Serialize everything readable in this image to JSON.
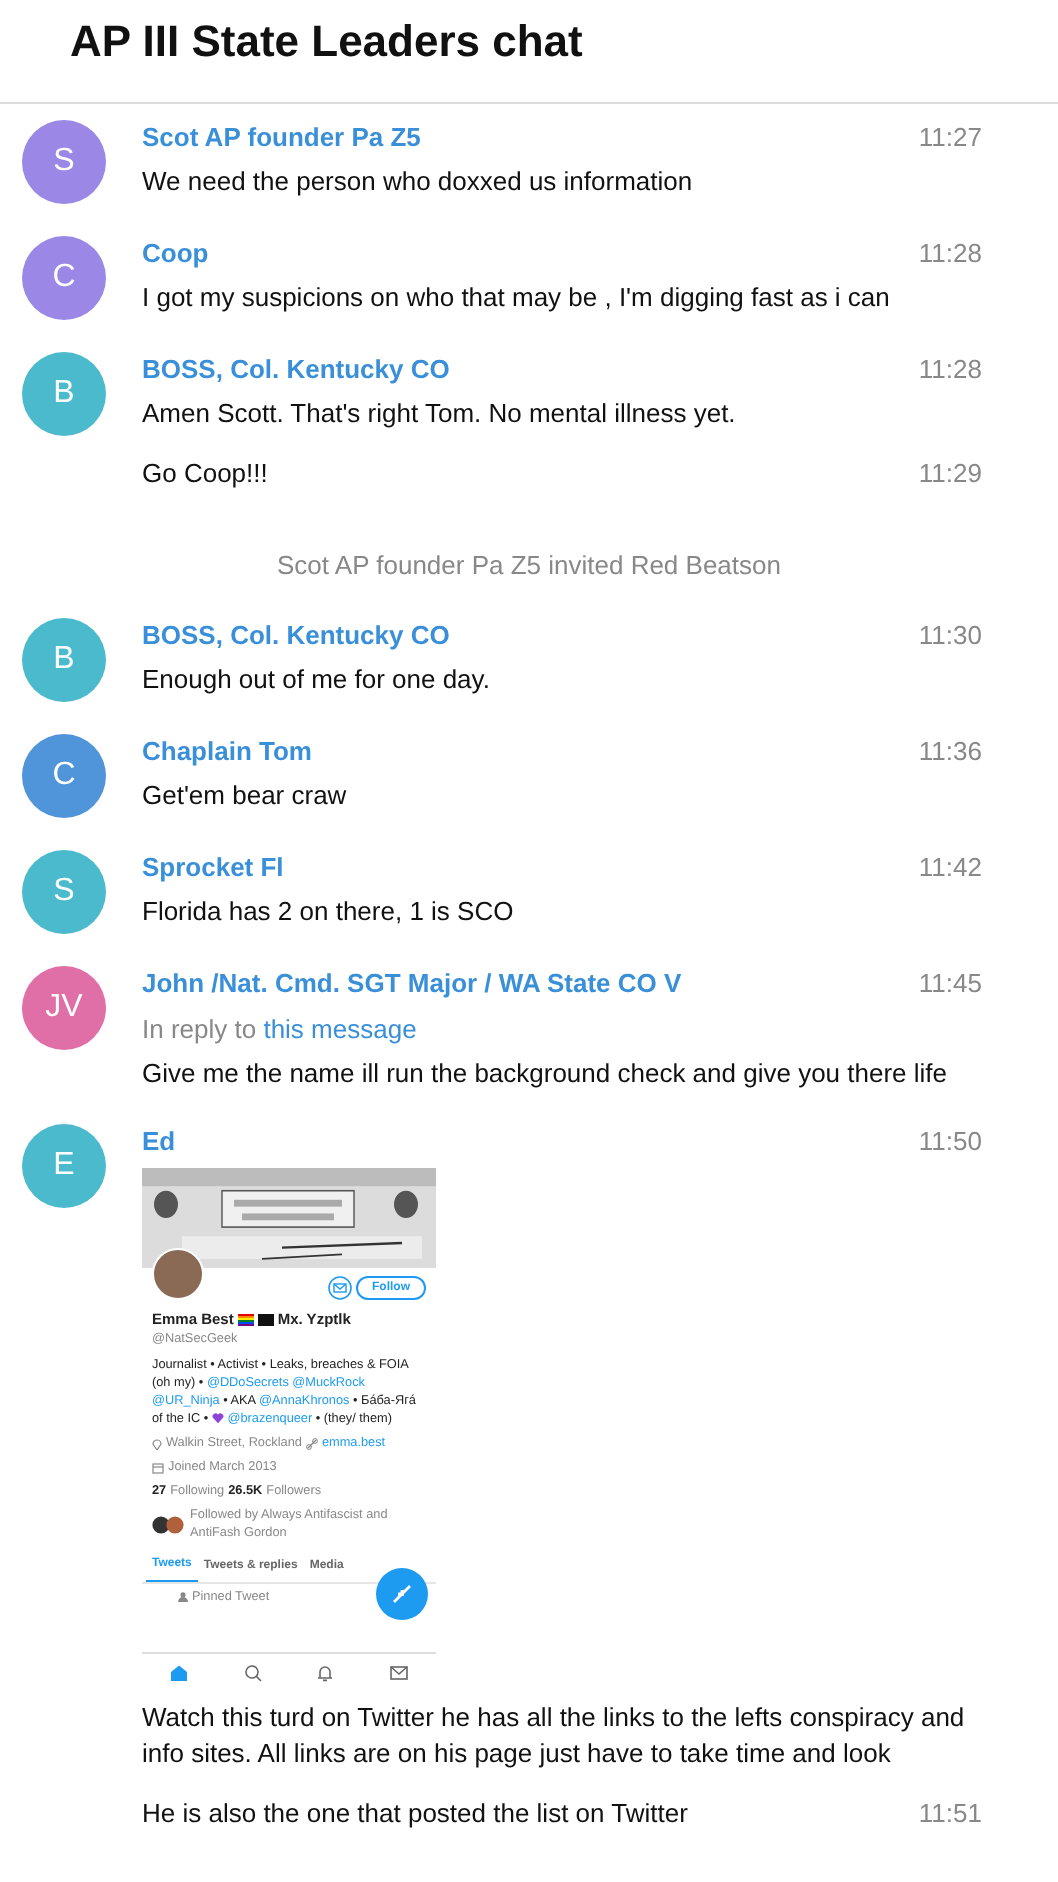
{
  "chat": {
    "title": "AP III State Leaders chat"
  },
  "items": [
    {
      "kind": "message",
      "initials": "S",
      "color": "#9b87e6",
      "author": "Scot AP founder Pa Z5",
      "time": "11:27",
      "text": "We need the person who doxxed us information"
    },
    {
      "kind": "message",
      "initials": "C",
      "color": "#9b87e6",
      "author": "Coop",
      "time": "11:28",
      "text": "I got my suspicions on who that may be , I'm digging fast as i can"
    },
    {
      "kind": "message",
      "initials": "B",
      "color": "#4bbacc",
      "author": "BOSS, Col. Kentucky CO",
      "time": "11:28",
      "text": "Amen Scott. That's right Tom. No mental illness yet.",
      "followups": [
        {
          "text": "Go Coop!!!",
          "time": "11:29"
        }
      ]
    },
    {
      "kind": "service",
      "text": "Scot AP founder Pa Z5 invited Red Beatson"
    },
    {
      "kind": "message",
      "initials": "B",
      "color": "#4bbacc",
      "author": "BOSS, Col. Kentucky CO",
      "time": "11:30",
      "text": "Enough out of me for one day."
    },
    {
      "kind": "message",
      "initials": "C",
      "color": "#5094d9",
      "author": "Chaplain Tom",
      "time": "11:36",
      "text": "Get'em bear craw"
    },
    {
      "kind": "message",
      "initials": "S",
      "color": "#4bbacc",
      "author": "Sprocket Fl",
      "time": "11:42",
      "text": "Florida has 2 on there, 1 is SCO"
    },
    {
      "kind": "message",
      "initials": "JV",
      "color": "#e06fa8",
      "author": "John /Nat. Cmd. SGT Major / WA State CO V",
      "time": "11:45",
      "reply": {
        "prefix": "In reply to",
        "link": "this message"
      },
      "text": "Give me the name ill run the background check and give you there life"
    },
    {
      "kind": "message",
      "initials": "E",
      "color": "#4bbacc",
      "author": "Ed",
      "time": "11:50",
      "media": {
        "kind": "profile-screenshot",
        "follow": "Follow",
        "name": "Emma Best",
        "name_suffix": "Mx. Yzptlk",
        "handle": "@NatSecGeek",
        "bio": [
          {
            "kind": "text",
            "text": "Journalist • Activist • Leaks, breaches & FOIA (oh my) •"
          },
          {
            "kind": "link",
            "text": "@DDoSecrets"
          },
          {
            "kind": "link",
            "text": "@MuckRock"
          },
          {
            "kind": "link",
            "text": "@UR_Ninja"
          },
          {
            "kind": "text",
            "text": "• AKA"
          },
          {
            "kind": "link",
            "text": "@AnnaKhronos"
          },
          {
            "kind": "text",
            "text": "• Бáба-Ягá of the IC •"
          },
          {
            "kind": "heart"
          },
          {
            "kind": "link",
            "text": "@brazenqueer"
          },
          {
            "kind": "text",
            "text": "• (they/ them)"
          }
        ],
        "location": "Walkin Street, Rockland",
        "website": "emma.best",
        "joined": "Joined March 2013",
        "following_count": "27",
        "following_label": "Following",
        "followers_count": "26.5K",
        "followers_label": "Followers",
        "followed_by": "Followed by Always Antifascist and AntiFash Gordon",
        "tabs": [
          {
            "label": "Tweets",
            "selected": true
          },
          {
            "label": "Tweets & replies",
            "selected": false
          },
          {
            "label": "Media",
            "selected": false
          }
        ],
        "pinned": "Pinned Tweet",
        "nav": [
          {
            "kind": "home",
            "selected": true
          },
          {
            "kind": "search",
            "selected": false
          },
          {
            "kind": "bell",
            "selected": false
          },
          {
            "kind": "mail",
            "selected": false
          }
        ]
      },
      "text": "Watch this turd on Twitter he has all the links to the lefts conspiracy and info sites. All links are on his page just have to take time and look",
      "followups": [
        {
          "text": "He is also the one that posted the list on Twitter",
          "time": "11:51"
        }
      ]
    }
  ]
}
